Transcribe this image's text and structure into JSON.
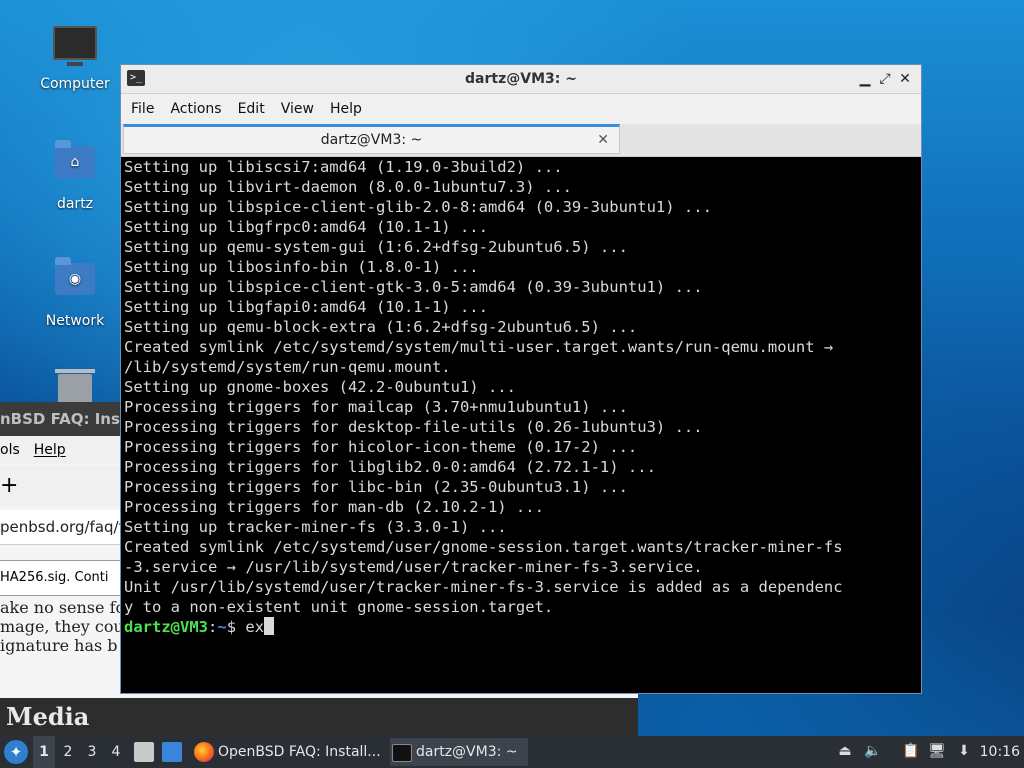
{
  "desktop": {
    "icons": [
      {
        "label": "Computer",
        "icon": "computer-icon"
      },
      {
        "label": "dartz",
        "icon": "home-folder-icon"
      },
      {
        "label": "Network",
        "icon": "network-folder-icon"
      },
      {
        "label": "",
        "icon": "trash-icon"
      }
    ]
  },
  "browser": {
    "title_fragment": "nBSD FAQ: Inst",
    "menu": [
      "ols",
      "Help"
    ],
    "new_tab_glyph": "+",
    "url_fragment": "penbsd.org/faq/faq",
    "notice_fragment": "HA256.sig. Conti",
    "content_lines": [
      "ake no sense fo",
      "mage, they cou",
      "ignature has b"
    ],
    "heading_fragment": "Media"
  },
  "terminal": {
    "title": "dartz@VM3: ~",
    "menu": [
      "File",
      "Actions",
      "Edit",
      "View",
      "Help"
    ],
    "tab_label": "dartz@VM3: ~",
    "lines": [
      "Setting up libiscsi7:amd64 (1.19.0-3build2) ...",
      "Setting up libvirt-daemon (8.0.0-1ubuntu7.3) ...",
      "Setting up libspice-client-glib-2.0-8:amd64 (0.39-3ubuntu1) ...",
      "Setting up libgfrpc0:amd64 (10.1-1) ...",
      "Setting up qemu-system-gui (1:6.2+dfsg-2ubuntu6.5) ...",
      "Setting up libosinfo-bin (1.8.0-1) ...",
      "Setting up libspice-client-gtk-3.0-5:amd64 (0.39-3ubuntu1) ...",
      "Setting up libgfapi0:amd64 (10.1-1) ...",
      "Setting up qemu-block-extra (1:6.2+dfsg-2ubuntu6.5) ...",
      "Created symlink /etc/systemd/system/multi-user.target.wants/run-qemu.mount →",
      "/lib/systemd/system/run-qemu.mount.",
      "Setting up gnome-boxes (42.2-0ubuntu1) ...",
      "Processing triggers for mailcap (3.70+nmu1ubuntu1) ...",
      "Processing triggers for desktop-file-utils (0.26-1ubuntu3) ...",
      "Processing triggers for hicolor-icon-theme (0.17-2) ...",
      "Processing triggers for libglib2.0-0:amd64 (2.72.1-1) ...",
      "Processing triggers for libc-bin (2.35-0ubuntu3.1) ...",
      "Processing triggers for man-db (2.10.2-1) ...",
      "Setting up tracker-miner-fs (3.3.0-1) ...",
      "Created symlink /etc/systemd/user/gnome-session.target.wants/tracker-miner-fs",
      "-3.service → /usr/lib/systemd/user/tracker-miner-fs-3.service.",
      "Unit /usr/lib/systemd/user/tracker-miner-fs-3.service is added as a dependenc",
      "y to a non-existent unit gnome-session.target."
    ],
    "prompt_user": "dartz@VM3",
    "prompt_sep": ":",
    "prompt_path": "~",
    "prompt_symbol": "$ ",
    "typed": "ex"
  },
  "taskbar": {
    "workspaces": [
      "1",
      "2",
      "3",
      "4"
    ],
    "active_workspace": "1",
    "tasks": [
      {
        "label": "OpenBSD FAQ: Install...",
        "icon": "firefox-icon"
      },
      {
        "label": "dartz@VM3: ~",
        "icon": "terminal-icon"
      }
    ],
    "clock": "10:16"
  }
}
